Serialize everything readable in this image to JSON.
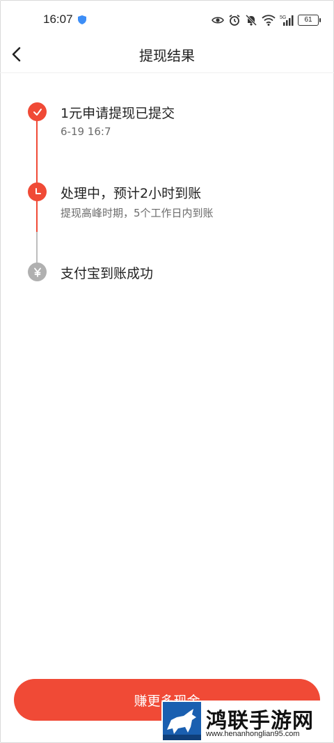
{
  "status_bar": {
    "time": "16:07",
    "network": "5G",
    "battery": "61",
    "icons": [
      "shield-icon",
      "eye-icon",
      "alarm-icon",
      "bell-off-icon",
      "wifi-icon",
      "signal-icon",
      "battery-icon"
    ]
  },
  "nav": {
    "title": "提现结果",
    "back_icon": "chevron-left-icon"
  },
  "steps": [
    {
      "title": "1元申请提现已提交",
      "subtitle": "6-19 16:7",
      "state": "done",
      "icon": "check-icon"
    },
    {
      "title": "处理中，预计2小时到账",
      "subtitle": "提现高峰时期，5个工作日内到账",
      "state": "active",
      "icon": "clock-icon"
    },
    {
      "title": "支付宝到账成功",
      "subtitle": "",
      "state": "pending",
      "icon": "yuan-icon"
    }
  ],
  "cta": {
    "label": "赚更多现金"
  },
  "watermark": {
    "brand": "鸿联手游网",
    "url": "www.henanhonglian95.com"
  },
  "colors": {
    "accent": "#f04a36",
    "pending": "#b0b0b0",
    "text": "#222222",
    "subtext": "#6b6b6b"
  }
}
